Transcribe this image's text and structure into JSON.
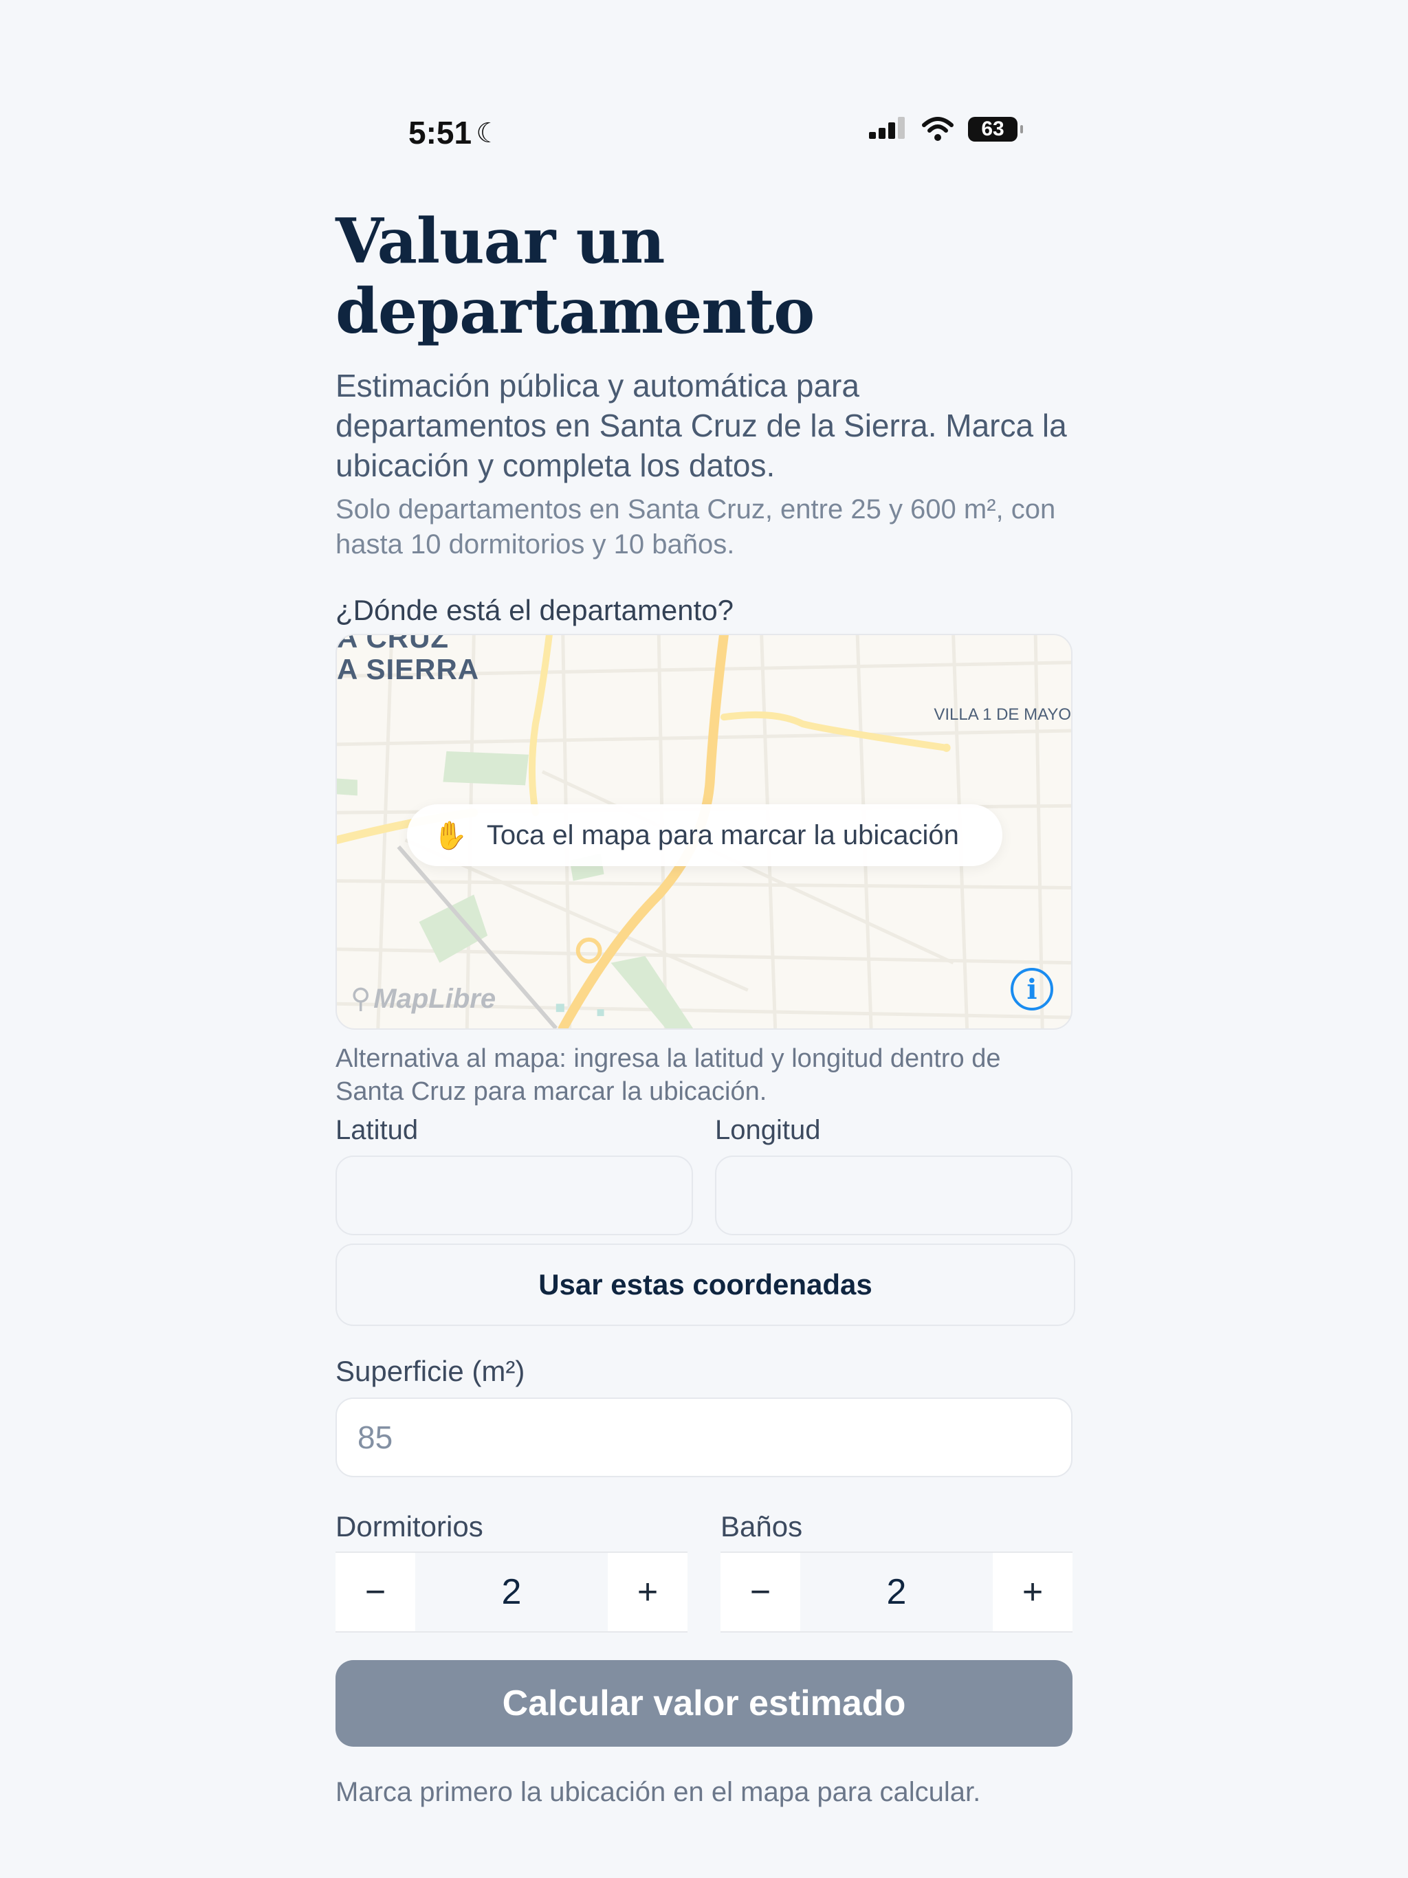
{
  "status": {
    "time": "5:51",
    "battery": "63"
  },
  "page": {
    "title_line1": "Valuar un",
    "title_line2": "departamento",
    "subtitle": "Estimación pública y automática para departamentos en Santa Cruz de la Sierra. Marca la ubicación y completa los datos.",
    "fine_print": "Solo departamentos en Santa Cruz, entre 25 y 600 m², con hasta 10 dormitorios y 10 baños.",
    "location_question": "¿Dónde está el departamento?"
  },
  "map": {
    "district_label_top": "A CRUZ",
    "district_label": "A SIERRA",
    "neighborhood_label": "VILLA 1 DE MAYO",
    "hint": "Toca el mapa para marcar la ubicación",
    "attribution": "MapLibre",
    "info_symbol": "i"
  },
  "coords": {
    "alt_text": "Alternativa al mapa: ingresa la latitud y longitud dentro de Santa Cruz para marcar la ubicación.",
    "lat_label": "Latitud",
    "lat_value": "",
    "lon_label": "Longitud",
    "lon_value": "",
    "use_button": "Usar estas coordenadas"
  },
  "surface": {
    "label": "Superficie (m²)",
    "placeholder": "85",
    "value": ""
  },
  "bedrooms": {
    "label": "Dormitorios",
    "value": "2",
    "minus": "−",
    "plus": "+"
  },
  "bathrooms": {
    "label": "Baños",
    "value": "2",
    "minus": "−",
    "plus": "+"
  },
  "actions": {
    "calculate": "Calcular valor estimado",
    "note": "Marca primero la ubicación en el mapa para calcular."
  },
  "colors": {
    "title": "#0f2540",
    "calc_disabled": "#818ea0",
    "info_blue": "#1a8cf0"
  }
}
